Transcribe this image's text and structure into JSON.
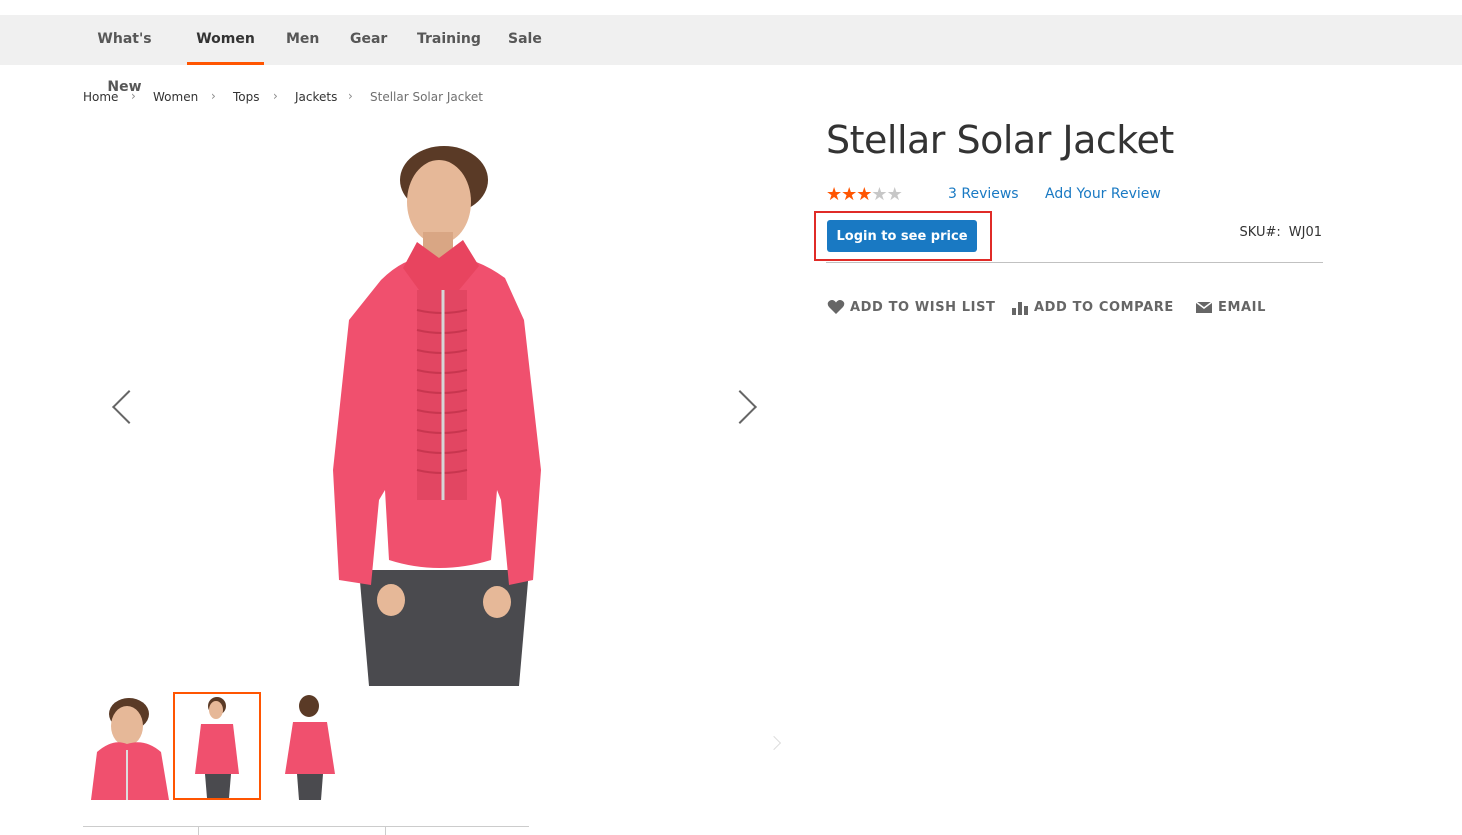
{
  "nav": {
    "items": [
      {
        "label": "What's New",
        "active": false
      },
      {
        "label": "Women",
        "active": true
      },
      {
        "label": "Men",
        "active": false
      },
      {
        "label": "Gear",
        "active": false
      },
      {
        "label": "Training",
        "active": false
      },
      {
        "label": "Sale",
        "active": false
      }
    ],
    "accent_color": "#ff5501"
  },
  "breadcrumb": {
    "items": [
      "Home",
      "Women",
      "Tops",
      "Jackets",
      "Stellar Solar Jacket"
    ],
    "separator": "›"
  },
  "product": {
    "title": "Stellar Solar Jacket",
    "rating_stars": 3,
    "rating_max": 5,
    "reviews_link": "3 Reviews",
    "add_review_link": "Add Your Review",
    "login_button": "Login to see price",
    "sku_label": "SKU#:",
    "sku_value": "WJ01",
    "actions": {
      "wishlist": "ADD TO WISH LIST",
      "compare": "ADD TO COMPARE",
      "email": "EMAIL"
    }
  },
  "gallery": {
    "thumbnails": [
      "front-closeup",
      "front-full",
      "back-view"
    ],
    "active_thumbnail": 1,
    "jacket_color": "#f0506e"
  },
  "colors": {
    "link": "#1979c3",
    "button": "#1979c3",
    "highlight_box": "#e02b27",
    "accent": "#ff5501"
  }
}
